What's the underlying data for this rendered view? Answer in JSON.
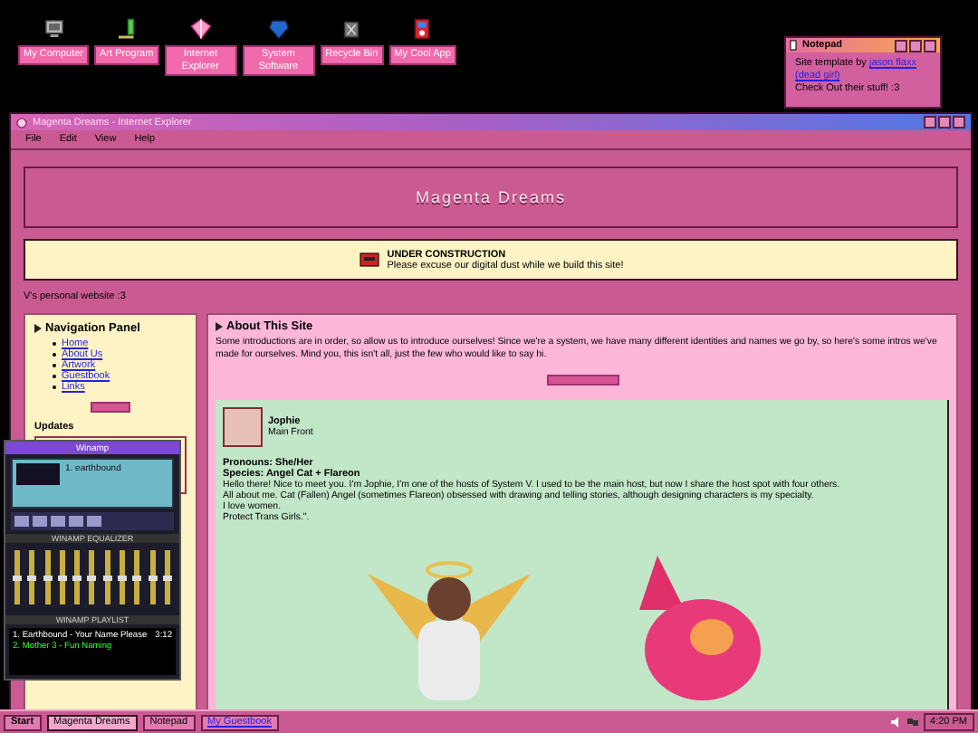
{
  "desktop_icons": [
    {
      "label": "My Computer",
      "kind": "computer"
    },
    {
      "label": "Art Program",
      "kind": "pencil"
    },
    {
      "label": "Internet Explorer",
      "kind": "cube"
    },
    {
      "label": "System Software",
      "kind": "gem"
    },
    {
      "label": "Recycle Bin",
      "kind": "bin"
    },
    {
      "label": "My Cool App",
      "kind": "player"
    }
  ],
  "notepad": {
    "title": "Notepad",
    "text": "Site template by",
    "link": "jason flaxx",
    "link_2": "(dead girl)",
    "note": "Check Out their stuff! :3"
  },
  "browser": {
    "title": "Magenta Dreams - Internet Explorer",
    "menu": [
      "File",
      "Edit",
      "View",
      "Help"
    ],
    "banner": "Magenta Dreams",
    "notice": {
      "title": "UNDER CONSTRUCTION",
      "text": "Please excuse our digital dust while we build this site!"
    },
    "tagline": "V's personal website :3",
    "nav": {
      "title": "Navigation Panel",
      "links": [
        "Home",
        "About Us",
        "Artwork",
        "Guestbook",
        "Links"
      ],
      "updates_title": "Updates"
    },
    "about": {
      "title": "About This Site",
      "text": "Some introductions are in order, so allow us to introduce ourselves! Since we're a system, we have many different identities and names we go by, so here's some intros we've made for ourselves. Mind you, this isn't all, just the few who would like to say hi.",
      "profile": {
        "name": "Jophie",
        "role": "Main Front",
        "pronouns": "Pronouns: She/Her",
        "species": "Species: Angel Cat + Flareon",
        "lines": [
          "Hello there! Nice to meet you. I'm Jophie, I'm one of the hosts of System V. I used to be the main host, but now I share the host spot with four others.",
          "All about me. Cat (Fallen) Angel (sometimes Flareon) obsessed with drawing and telling stories, although designing characters is my specialty.",
          "I love women.",
          "Protect Trans Girls.\"."
        ]
      }
    }
  },
  "winamp": {
    "title": "Winamp",
    "track": "1. earthbound",
    "eq_title": "WINAMP EQUALIZER",
    "eq_bands": [
      {
        "level": 0.5
      },
      {
        "level": 0.5
      },
      {
        "level": 0.5
      },
      {
        "level": 0.5
      },
      {
        "level": 0.5
      },
      {
        "level": 0.5
      },
      {
        "level": 0.5
      },
      {
        "level": 0.5
      },
      {
        "level": 0.5
      },
      {
        "level": 0.5
      },
      {
        "level": 0.5
      }
    ],
    "playlist_title": "WINAMP PLAYLIST",
    "playlist": [
      {
        "title": "1. Earthbound - Your Name Please",
        "time": "3:12",
        "selected": false
      },
      {
        "title": "2. Mother 3 - Fun Naming",
        "selected": true
      }
    ]
  },
  "taskbar": {
    "start": "Start",
    "items": [
      {
        "label": "Magenta Dreams",
        "kind": "window",
        "selected": true
      },
      {
        "label": "Notepad",
        "kind": "window",
        "selected": false
      },
      {
        "label": "My Guestbook",
        "kind": "link",
        "selected": false
      }
    ],
    "clock": "4:20 PM"
  }
}
